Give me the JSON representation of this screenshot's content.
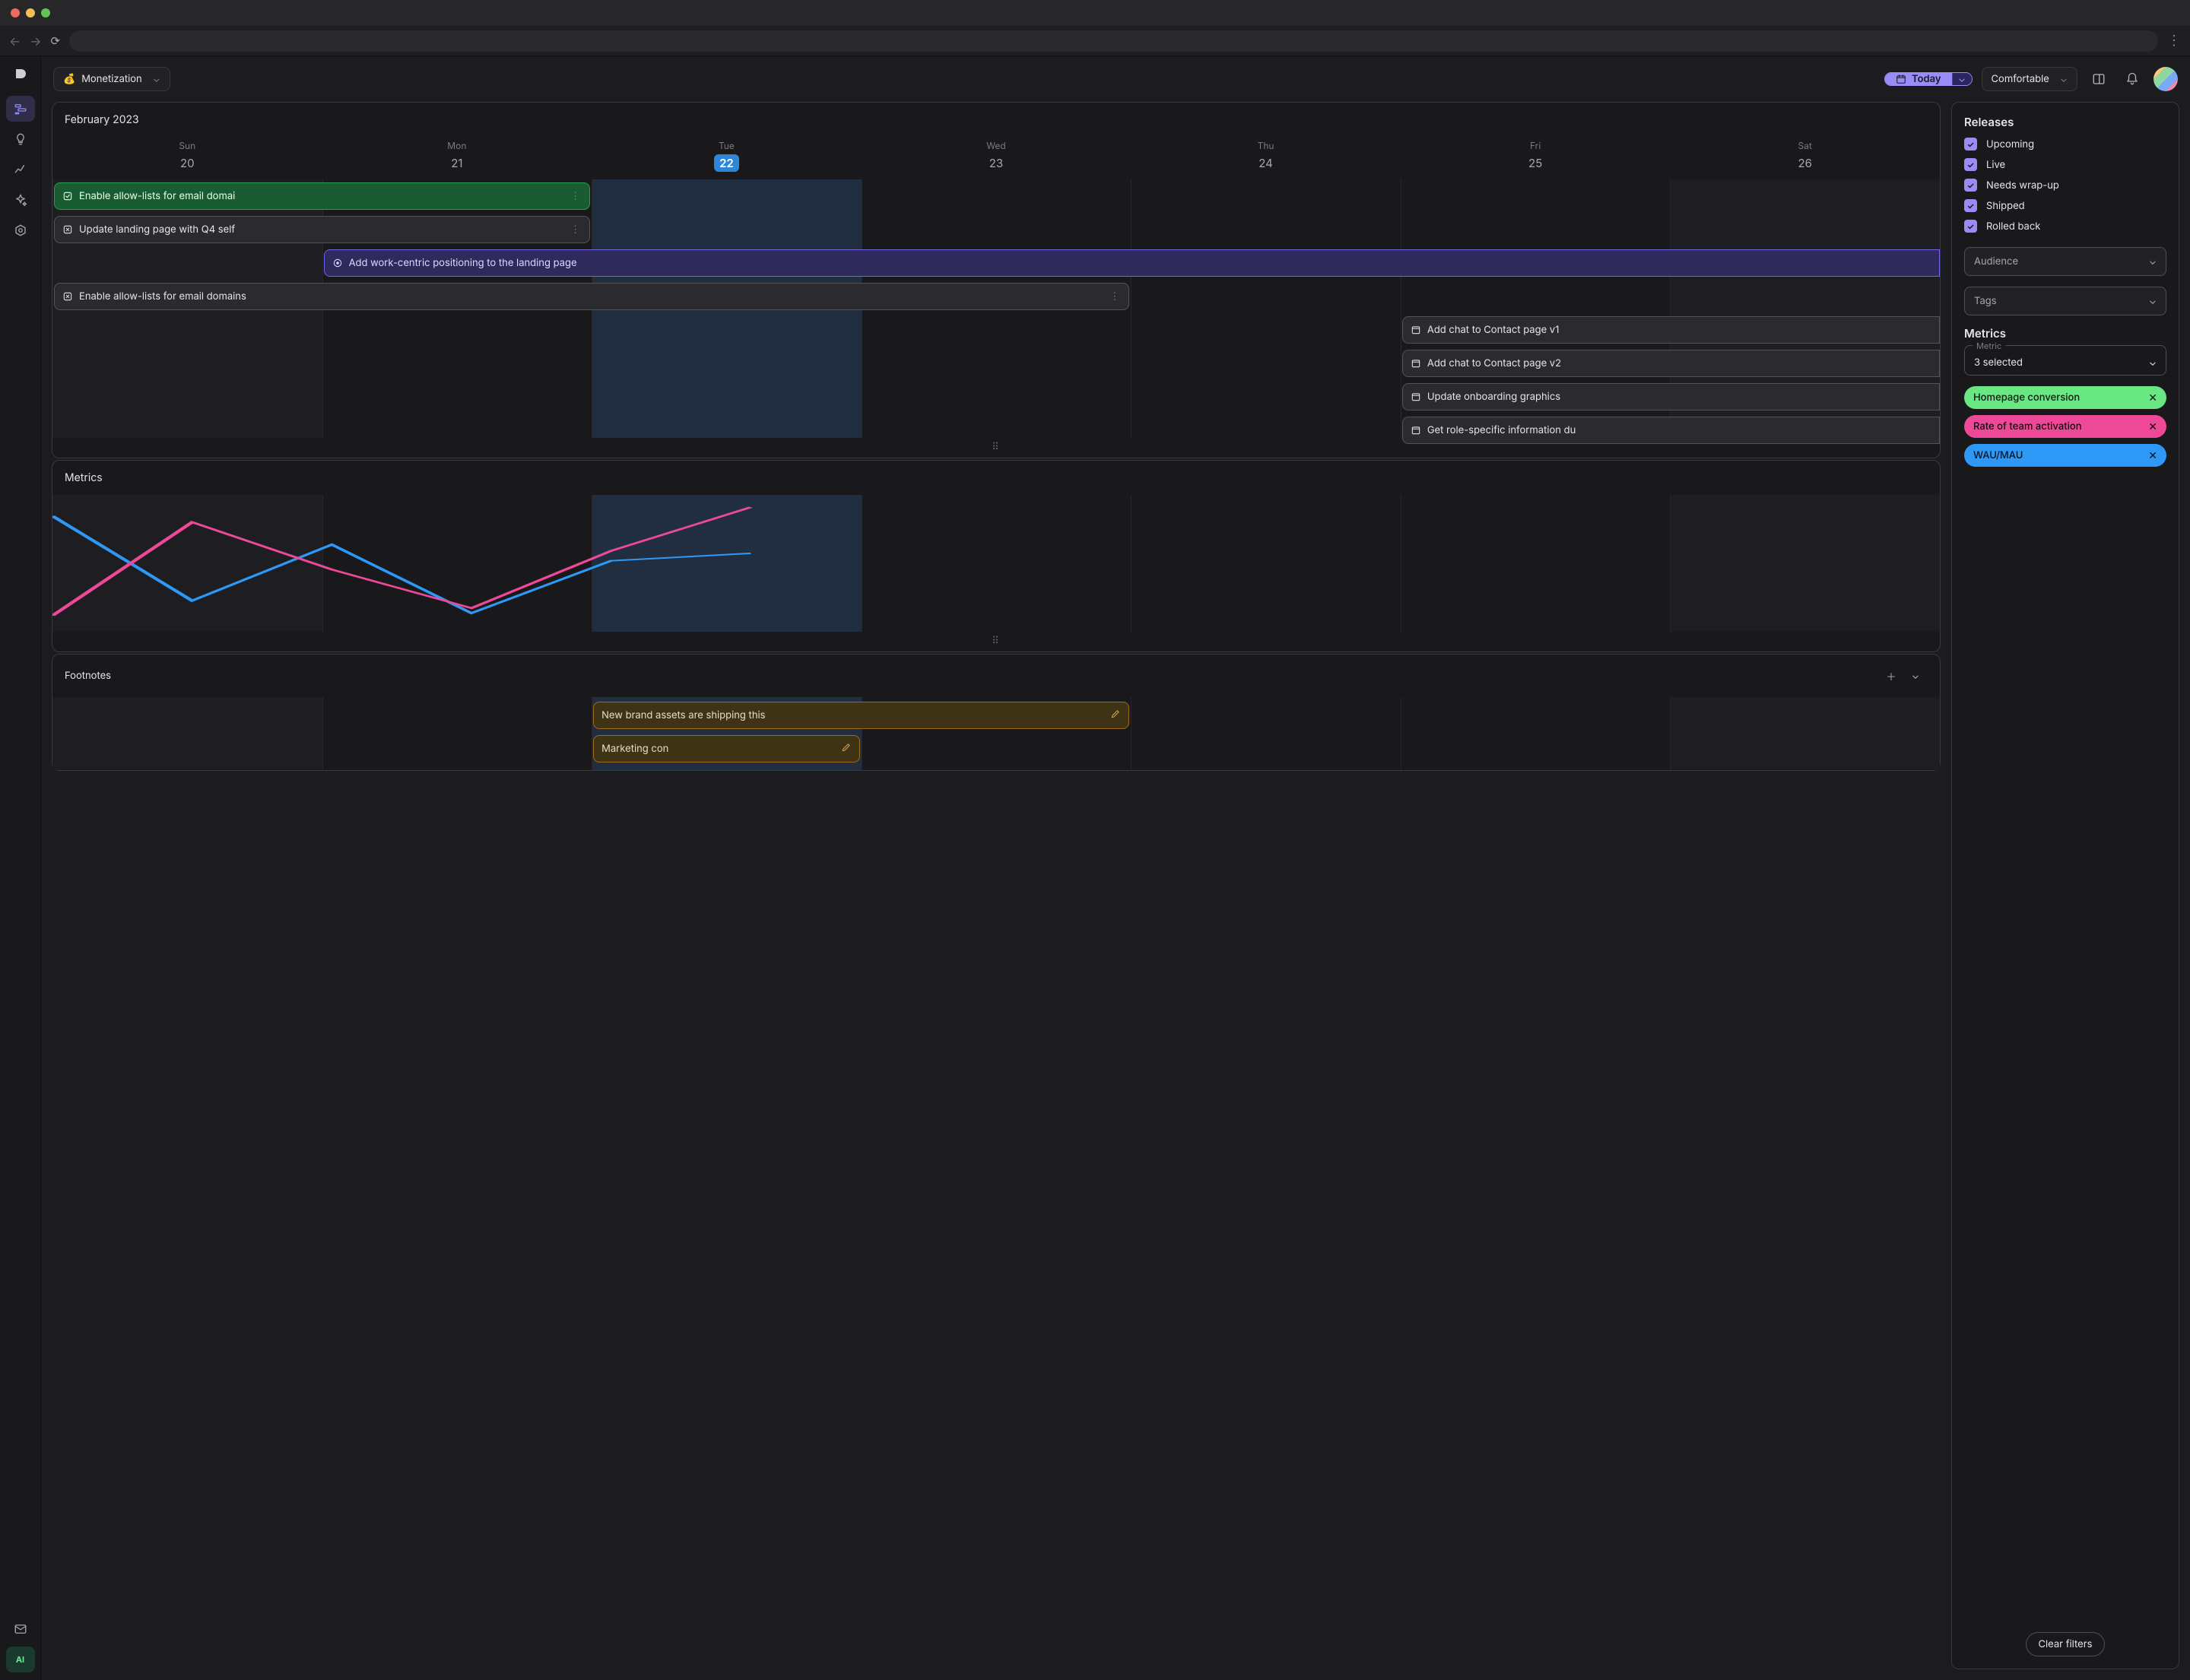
{
  "browser": {},
  "topbar": {
    "workspace_emoji": "💰",
    "workspace_label": "Monetization",
    "today_label": "Today",
    "density_label": "Comfortable"
  },
  "calendar": {
    "title": "February 2023",
    "days": [
      {
        "dow": "Sun",
        "num": "20",
        "today": false
      },
      {
        "dow": "Mon",
        "num": "21",
        "today": false
      },
      {
        "dow": "Tue",
        "num": "22",
        "today": true
      },
      {
        "dow": "Wed",
        "num": "23",
        "today": false
      },
      {
        "dow": "Thu",
        "num": "24",
        "today": false
      },
      {
        "dow": "Fri",
        "num": "25",
        "today": false
      },
      {
        "dow": "Sat",
        "num": "26",
        "today": false
      }
    ],
    "events": {
      "e1": "Enable allow-lists for email domai",
      "e2": "Update landing page with Q4 self",
      "e3": "Add work-centric positioning to the landing page",
      "e4": "Enable allow-lists for email domains",
      "e5": "Add chat to Contact page v1",
      "e6": "Add chat to Contact page v2",
      "e7": "Update onboarding graphics",
      "e8": "Get role-specific information du"
    }
  },
  "metrics_panel": {
    "title": "Metrics"
  },
  "footnotes_panel": {
    "title": "Footnotes",
    "n1": "New brand assets are shipping this",
    "n2": "Marketing con"
  },
  "side": {
    "releases_title": "Releases",
    "filters": {
      "upcoming": "Upcoming",
      "live": "Live",
      "wrap": "Needs wrap-up",
      "shipped": "Shipped",
      "rolled": "Rolled back"
    },
    "audience_label": "Audience",
    "tags_label": "Tags",
    "metrics_title": "Metrics",
    "metric_field_label": "Metric",
    "metric_field_value": "3 selected",
    "chips": {
      "a": "Homepage conversion",
      "b": "Rate of team activation",
      "c": "WAU/MAU"
    },
    "clear_label": "Clear filters"
  },
  "chart_data": {
    "type": "line",
    "x": [
      0,
      1,
      2,
      3,
      4,
      5
    ],
    "xlim_days": [
      "Sun",
      "Mon",
      "Tue",
      "Wed",
      "Thu",
      "Fri",
      "Sat"
    ],
    "series": [
      {
        "name": "Homepage conversion",
        "color": "#2e98f6",
        "values": [
          88,
          20,
          65,
          10,
          52,
          58
        ]
      },
      {
        "name": "Rate of team activation",
        "color": "#ed4998",
        "values": [
          8,
          83,
          45,
          14,
          60,
          95
        ]
      }
    ],
    "ylim": [
      0,
      100
    ],
    "note": "values are relative positions estimated from pixels (0=bottom,100=top)"
  }
}
